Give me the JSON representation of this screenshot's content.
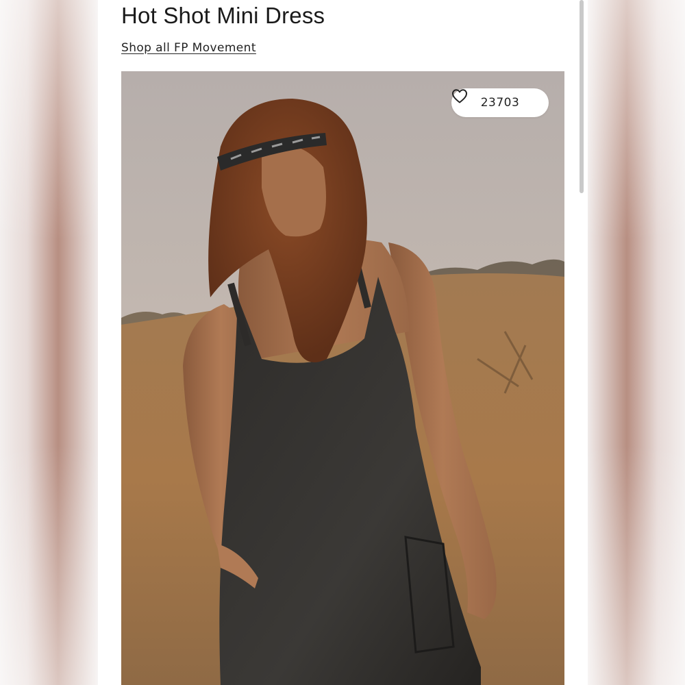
{
  "product": {
    "title": "Hot Shot Mini Dress",
    "shop_link": "Shop all FP Movement",
    "likes": "23703"
  },
  "icons": {
    "like": "heart-outline-icon"
  },
  "image": {
    "subject": "model",
    "description": ""
  },
  "colors": {
    "text": "#1a1a1a",
    "background": "#ffffff",
    "pill": "#ffffff"
  }
}
